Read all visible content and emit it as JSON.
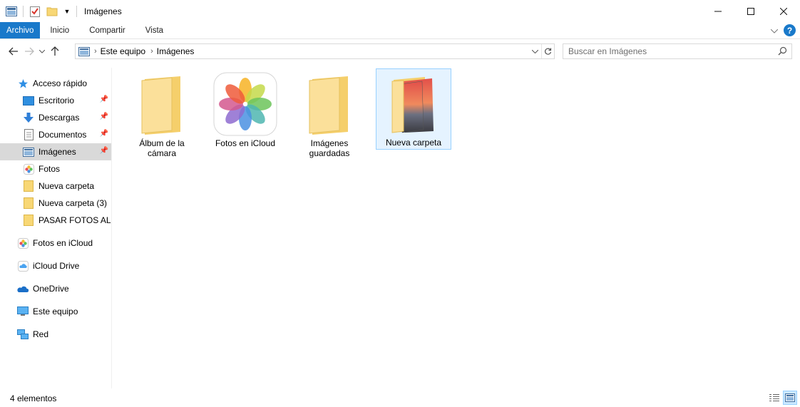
{
  "window": {
    "title": "Imágenes"
  },
  "ribbon": {
    "tabs": [
      {
        "label": "Archivo"
      },
      {
        "label": "Inicio"
      },
      {
        "label": "Compartir"
      },
      {
        "label": "Vista"
      }
    ],
    "help_label": "?"
  },
  "address": {
    "path": [
      "Este equipo",
      "Imágenes"
    ]
  },
  "search": {
    "placeholder": "Buscar en Imágenes"
  },
  "sidebar": {
    "items": [
      {
        "label": "Acceso rápido",
        "icon": "star-icon"
      },
      {
        "label": "Escritorio",
        "icon": "desktop-icon",
        "pinned": true
      },
      {
        "label": "Descargas",
        "icon": "download-icon",
        "pinned": true
      },
      {
        "label": "Documentos",
        "icon": "document-icon",
        "pinned": true
      },
      {
        "label": "Imágenes",
        "icon": "pictures-icon",
        "pinned": true,
        "selected": true
      },
      {
        "label": "Fotos",
        "icon": "photos-icon"
      },
      {
        "label": "Nueva carpeta",
        "icon": "folder-icon"
      },
      {
        "label": "Nueva carpeta (3)",
        "icon": "folder-icon"
      },
      {
        "label": "PASAR FOTOS AL IP",
        "icon": "folder-icon"
      },
      {
        "label": "Fotos en iCloud",
        "icon": "photos-icon"
      },
      {
        "label": "iCloud Drive",
        "icon": "icloud-icon"
      },
      {
        "label": "OneDrive",
        "icon": "onedrive-icon"
      },
      {
        "label": "Este equipo",
        "icon": "computer-icon"
      },
      {
        "label": "Red",
        "icon": "network-icon"
      }
    ]
  },
  "content": {
    "items": [
      {
        "label": "Álbum de la cámara",
        "icon": "folder-icon"
      },
      {
        "label": "Fotos en iCloud",
        "icon": "icloud-photos-icon"
      },
      {
        "label": "Imágenes guardadas",
        "icon": "folder-icon"
      },
      {
        "label": "Nueva carpeta",
        "icon": "folder-with-image-icon",
        "selected": true
      }
    ]
  },
  "status": {
    "count_text": "4 elementos"
  },
  "colors": {
    "accent": "#1979ca",
    "selection": "#e5f3ff",
    "folder": "#f8d775"
  }
}
